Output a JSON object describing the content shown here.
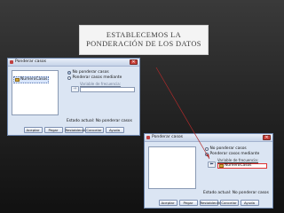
{
  "slide": {
    "title_line1": "ESTABLECEMOS LA",
    "title_line2": "PONDERACIÓN DE LOS DATOS"
  },
  "colors": {
    "dialog_bg": "#dbe5f3",
    "accent": "#d04040",
    "arrow": "#b02a2a"
  },
  "dialog1": {
    "title": "Ponderar casos",
    "variable": "NumeroCasos",
    "option_no": "No ponderar casos",
    "option_yes": "Ponderar casos mediante",
    "freq_label": "Variable de frecuencia:",
    "status": "Estado actual: No ponderar casos",
    "buttons": [
      "Aceptar",
      "Pegar",
      "Restablecer",
      "Cancelar",
      "Ayuda"
    ]
  },
  "dialog2": {
    "title": "Ponderar casos",
    "option_no": "No ponderar casos",
    "option_yes": "Ponderar casos mediante",
    "freq_label": "Variable de frecuencia:",
    "freq_value": "NumeroCasos",
    "status": "Estado actual: No ponderar casos",
    "buttons": [
      "Aceptar",
      "Pegar",
      "Restablecer",
      "Cancelar",
      "Ayuda"
    ]
  },
  "icons": {
    "close": "close-icon",
    "variable": "scale-variable-icon",
    "move": "right-arrow-icon"
  }
}
